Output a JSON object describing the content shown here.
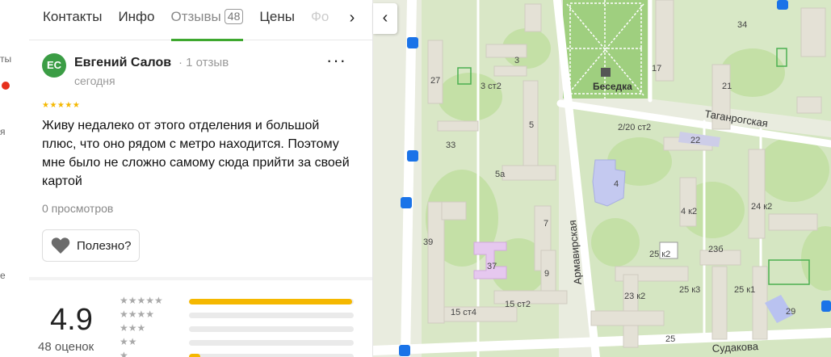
{
  "left_fragments": [
    "ты",
    "я",
    "е"
  ],
  "tabs": [
    {
      "label": "Контакты"
    },
    {
      "label": "Инфо"
    },
    {
      "label": "Отзывы",
      "count": "48"
    },
    {
      "label": "Цены"
    },
    {
      "label": "Фо"
    }
  ],
  "review": {
    "avatar_initials": "ЕС",
    "author": "Евгений Салов",
    "author_reviews": "· 1 отзыв",
    "date": "сегодня",
    "stars": "★★★★★",
    "text": "Живу недалеко от этого отделения и большой плюс, что оно рядом с метро находится. Поэтому мне было не сложно самому сюда прийти за своей картой",
    "views": "0 просмотров",
    "helpful_label": "Полезно?"
  },
  "rating": {
    "score": "4.9",
    "votes": "48 оценок",
    "rows": [
      {
        "stars": "★★★★★",
        "fraction": 0.99
      },
      {
        "stars": "★★★★",
        "fraction": 0.0
      },
      {
        "stars": "★★★",
        "fraction": 0.0
      },
      {
        "stars": "★★",
        "fraction": 0.0
      },
      {
        "stars": "★",
        "fraction": 0.07
      }
    ]
  },
  "map": {
    "streets": [
      "Таганрогская",
      "Армавирская",
      "Судакова"
    ],
    "poi": "Беседка",
    "house_numbers": [
      "34",
      "27",
      "3",
      "3 ст2",
      "17",
      "21",
      "2/20 ст2",
      "22",
      "33",
      "5",
      "5а",
      "4",
      "4 к2",
      "24 к2",
      "39",
      "7",
      "37",
      "9",
      "15 ст4",
      "15 ст2",
      "25 к2",
      "23б",
      "23 к2",
      "25 к3",
      "25 к1",
      "29",
      "25"
    ],
    "colors": {
      "green": "#c9e5ae",
      "park": "#9fcf7f",
      "building": "#e4e1d6",
      "road": "#ffffff",
      "school": "#c4c9f0",
      "hospital": "#e6c8ef",
      "transit": "#1a73e8"
    }
  }
}
